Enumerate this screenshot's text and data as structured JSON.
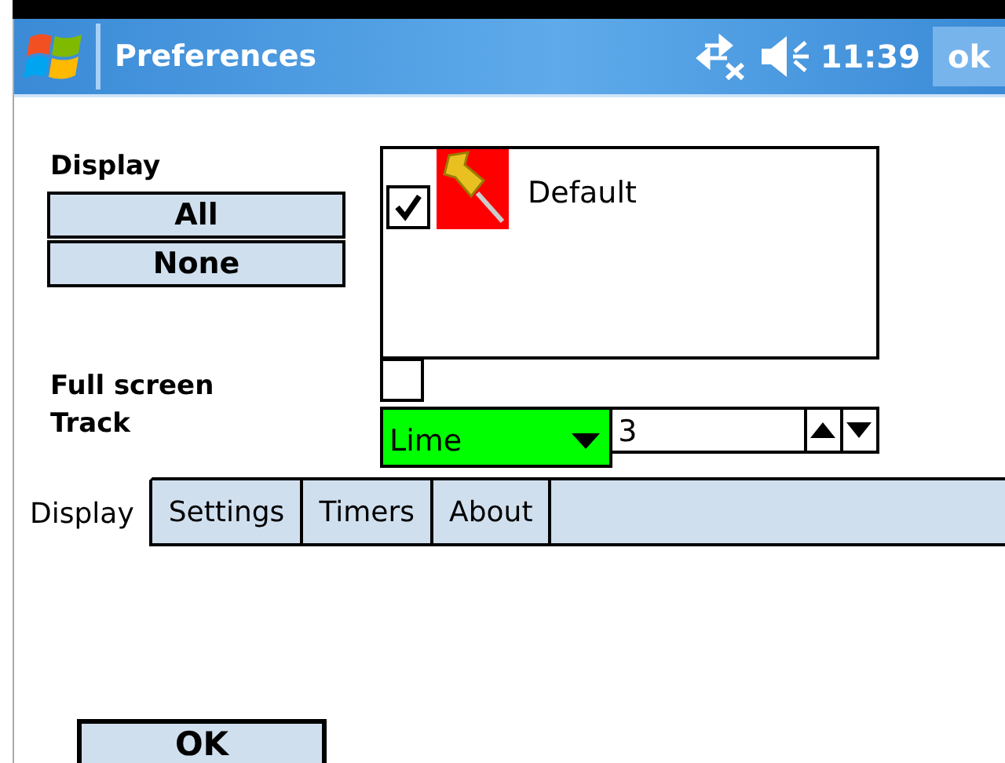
{
  "title_bar": {
    "title": "Preferences",
    "time": "11:39",
    "ok_button": "ok"
  },
  "display": {
    "label": "Display",
    "buttons": [
      "All",
      "None"
    ],
    "items": [
      {
        "label": "Default",
        "checked": true
      }
    ]
  },
  "full_screen": {
    "label": "Full screen",
    "checked": false
  },
  "track": {
    "label": "Track",
    "color_select": {
      "value": "Lime",
      "color": "#00ff00"
    },
    "number": {
      "value": "3"
    }
  },
  "tabs": [
    {
      "label": "Display",
      "selected": true
    },
    {
      "label": "Settings",
      "selected": false
    },
    {
      "label": "Timers",
      "selected": false
    },
    {
      "label": "About",
      "selected": false
    }
  ],
  "ok_button": "OK"
}
